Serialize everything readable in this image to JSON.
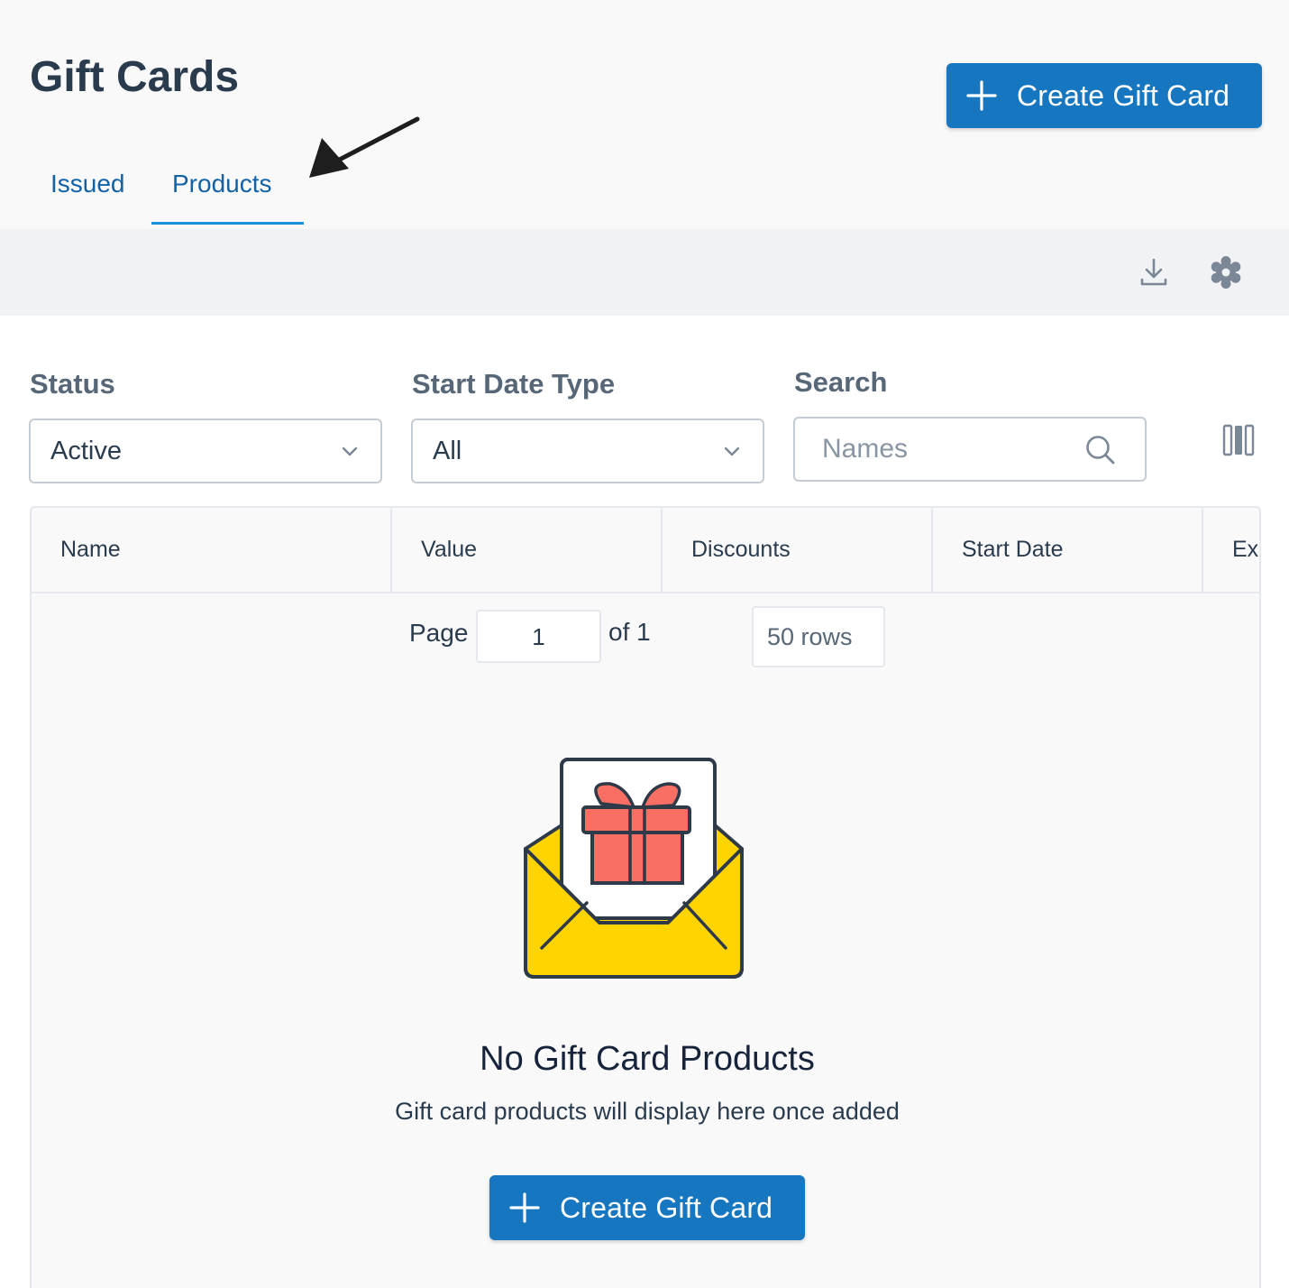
{
  "header": {
    "title": "Gift Cards",
    "create_button_label": "Create Gift Card"
  },
  "tabs": [
    {
      "label": "Issued",
      "active": false
    },
    {
      "label": "Products",
      "active": true
    }
  ],
  "toolbar": {
    "download_icon": "download-icon",
    "settings_icon": "gear-icon"
  },
  "filters": {
    "status": {
      "label": "Status",
      "value": "Active"
    },
    "start_date_type": {
      "label": "Start Date Type",
      "value": "All"
    },
    "search": {
      "label": "Search",
      "placeholder": "Names"
    }
  },
  "table": {
    "columns": [
      "Name",
      "Value",
      "Discounts",
      "Start Date",
      "Exp"
    ]
  },
  "pagination": {
    "page_label": "Page",
    "current_page": "1",
    "of_label": "of 1",
    "rows_label": "50 rows"
  },
  "empty_state": {
    "title": "No Gift Card Products",
    "subtitle": "Gift card products will display here once added",
    "button_label": "Create Gift Card"
  },
  "colors": {
    "primary": "#1776c0",
    "tab_text": "#1162a7",
    "tab_underline": "#1990db",
    "envelope_yellow": "#ffd400",
    "gift_red": "#fa6f64",
    "outline": "#2e3a47"
  }
}
